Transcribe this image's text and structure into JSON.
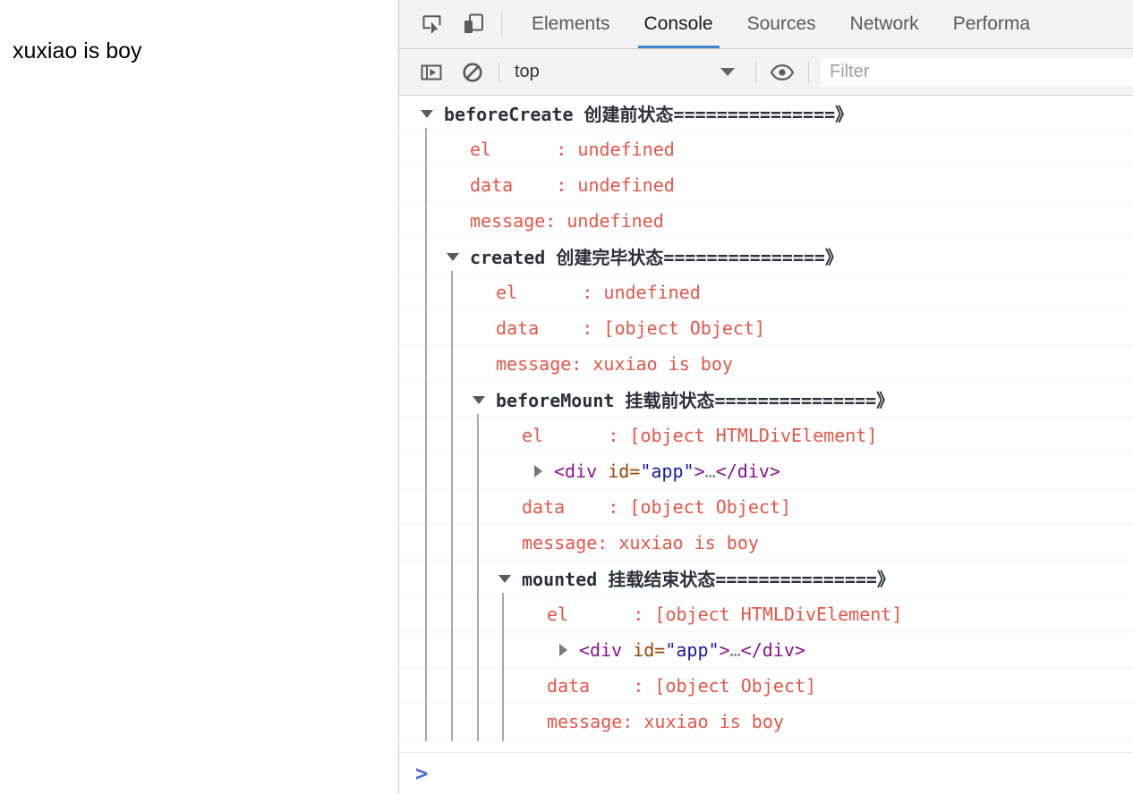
{
  "page": {
    "app_text": "xuxiao is boy"
  },
  "devtools": {
    "toolbar_icons": [
      {
        "name": "inspect-element-icon"
      },
      {
        "name": "device-toolbar-icon"
      }
    ],
    "tabs": [
      {
        "label": "Elements",
        "active": false
      },
      {
        "label": "Console",
        "active": true
      },
      {
        "label": "Sources",
        "active": false
      },
      {
        "label": "Network",
        "active": false
      },
      {
        "label": "Performa",
        "active": false
      }
    ],
    "filterbar": {
      "sidebar_toggle_icon": "console-sidebar-icon",
      "clear_icon": "clear-console-icon",
      "context_label": "top",
      "eye_icon": "live-expression-eye-icon",
      "filter_value": "",
      "filter_placeholder": "Filter"
    },
    "accent_color": "#4285cd",
    "error_text_color": "#e45649",
    "group_title_color": "#2b303b",
    "prompt_caret": ">"
  },
  "console": {
    "rows": [
      {
        "kind": "group",
        "depth": 0,
        "title": "beforeCreate 创建前状态===============》"
      },
      {
        "kind": "kv",
        "depth": 1,
        "text": "el      : undefined"
      },
      {
        "kind": "kv",
        "depth": 1,
        "text": "data    : undefined"
      },
      {
        "kind": "kv",
        "depth": 1,
        "text": "message: undefined"
      },
      {
        "kind": "group",
        "depth": 1,
        "title": "created 创建完毕状态===============》"
      },
      {
        "kind": "kv",
        "depth": 2,
        "text": "el      : undefined"
      },
      {
        "kind": "kv",
        "depth": 2,
        "text": "data    : [object Object]"
      },
      {
        "kind": "kv",
        "depth": 2,
        "text": "message: xuxiao is boy"
      },
      {
        "kind": "group",
        "depth": 2,
        "title": "beforeMount 挂载前状态===============》"
      },
      {
        "kind": "kv",
        "depth": 3,
        "text": "el      : [object HTMLDivElement]"
      },
      {
        "kind": "dom",
        "depth": 3,
        "tag_open": "<div",
        "attr": " id=",
        "value": "\"app\"",
        "tag_close": ">",
        "ellipsis": "…",
        "tag_end": "</div>"
      },
      {
        "kind": "kv",
        "depth": 3,
        "text": "data    : [object Object]"
      },
      {
        "kind": "kv",
        "depth": 3,
        "text": "message: xuxiao is boy"
      },
      {
        "kind": "group",
        "depth": 3,
        "title": "mounted 挂载结束状态===============》"
      },
      {
        "kind": "kv",
        "depth": 4,
        "text": "el      : [object HTMLDivElement]"
      },
      {
        "kind": "dom",
        "depth": 4,
        "tag_open": "<div",
        "attr": " id=",
        "value": "\"app\"",
        "tag_close": ">",
        "ellipsis": "…",
        "tag_end": "</div>"
      },
      {
        "kind": "kv",
        "depth": 4,
        "text": "data    : [object Object]"
      },
      {
        "kind": "kv",
        "depth": 4,
        "text": "message: xuxiao is boy"
      }
    ]
  }
}
